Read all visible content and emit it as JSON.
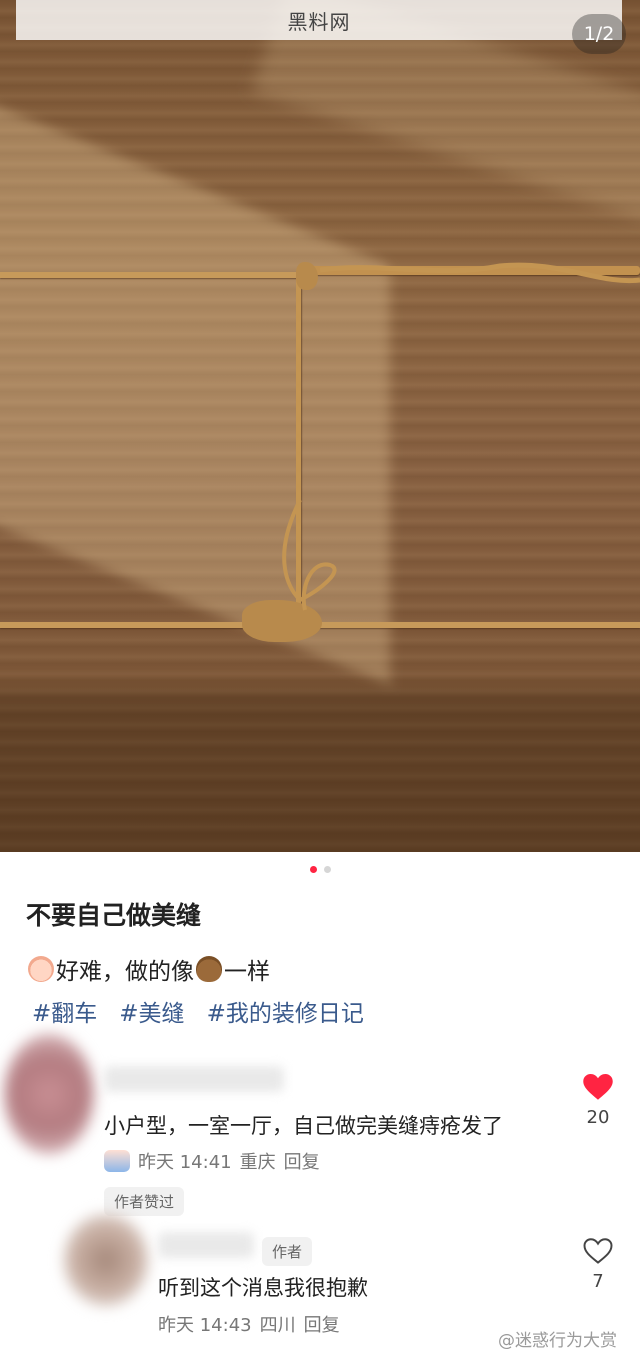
{
  "header": {
    "site_title": "黑料网",
    "image_counter": "1/2"
  },
  "carousel": {
    "total": 2,
    "active_index": 0
  },
  "post": {
    "title": "不要自己做美缝",
    "desc_part1": "好难，做的像",
    "desc_part2": "一样",
    "emoji_1": "baby-face-icon",
    "emoji_2": "poop-icon",
    "tags": [
      "#翻车",
      "#美缝",
      "#我的装修日记"
    ]
  },
  "comments": [
    {
      "text": "小户型，一室一厅，自己做完美缝痔疮发了",
      "time": "昨天 14:41",
      "location": "重庆",
      "reply_label": "回复",
      "liked": true,
      "like_count": "20",
      "like_color": "#ff2442",
      "badge": "作者赞过"
    },
    {
      "author_tag": "作者",
      "text": "听到这个消息我很抱歉",
      "time": "昨天 14:43",
      "location": "四川",
      "reply_label": "回复",
      "liked": false,
      "like_count": "7"
    }
  ],
  "watermark": "@迷惑行为大赏",
  "colors": {
    "accent": "#ff2442",
    "tag": "#3a5a8c"
  }
}
